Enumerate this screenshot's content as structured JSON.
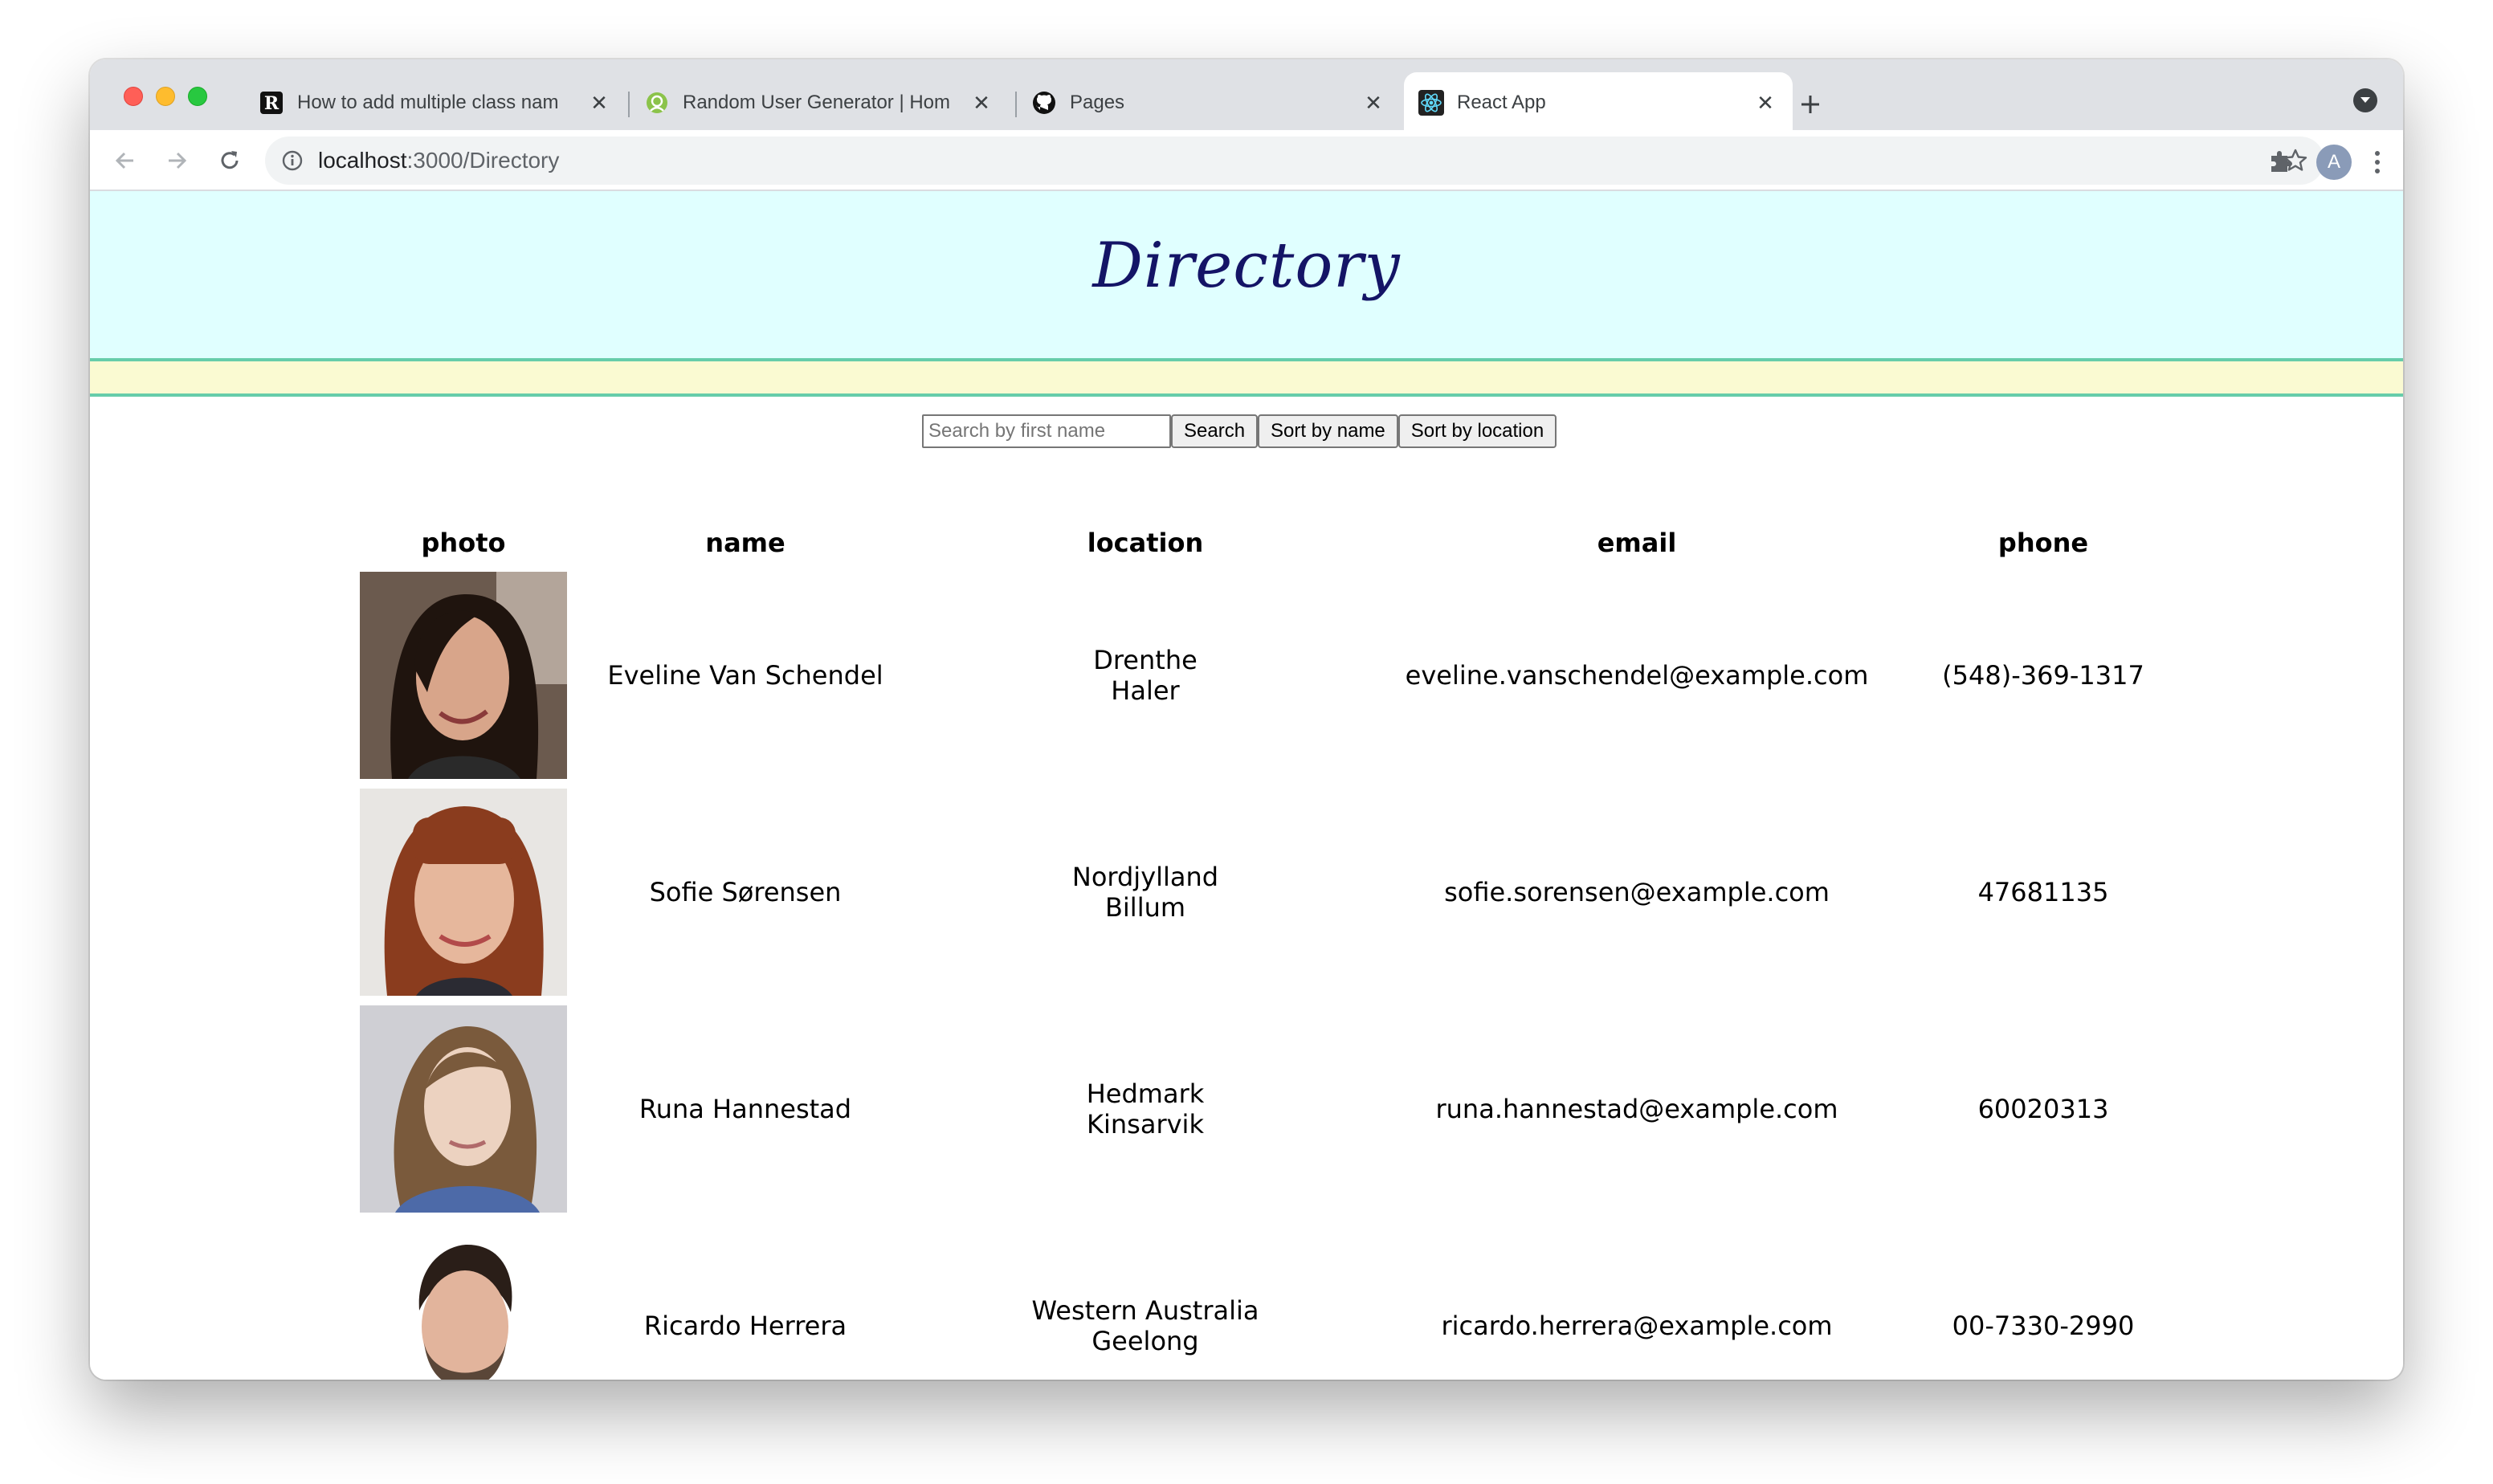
{
  "browser": {
    "tabs": [
      {
        "title": "How to add multiple class nam",
        "icon": "r-letter-icon"
      },
      {
        "title": "Random User Generator | Hom",
        "icon": "smiley-icon"
      },
      {
        "title": "Pages",
        "icon": "github-icon"
      },
      {
        "title": "React App",
        "icon": "react-icon",
        "active": true
      }
    ],
    "url_host": "localhost",
    "url_path": ":3000/Directory",
    "profile_initial": "A"
  },
  "page": {
    "heading": "Directory",
    "search_placeholder": "Search by first name",
    "search_button": "Search",
    "sort_name_button": "Sort by name",
    "sort_location_button": "Sort by location"
  },
  "table": {
    "headers": {
      "photo": "photo",
      "name": "name",
      "location": "location",
      "email": "email",
      "phone": "phone"
    },
    "rows": [
      {
        "name": "Eveline Van Schendel",
        "state": "Drenthe",
        "city": "Haler",
        "email": "eveline.vanschendel@example.com",
        "phone": "(548)-369-1317"
      },
      {
        "name": "Sofie Sørensen",
        "state": "Nordjylland",
        "city": "Billum",
        "email": "sofie.sorensen@example.com",
        "phone": "47681135"
      },
      {
        "name": "Runa Hannestad",
        "state": "Hedmark",
        "city": "Kinsarvik",
        "email": "runa.hannestad@example.com",
        "phone": "60020313"
      },
      {
        "name": "Ricardo Herrera",
        "state": "Western Australia",
        "city": "Geelong",
        "email": "ricardo.herrera@example.com",
        "phone": "00-7330-2990"
      }
    ]
  }
}
